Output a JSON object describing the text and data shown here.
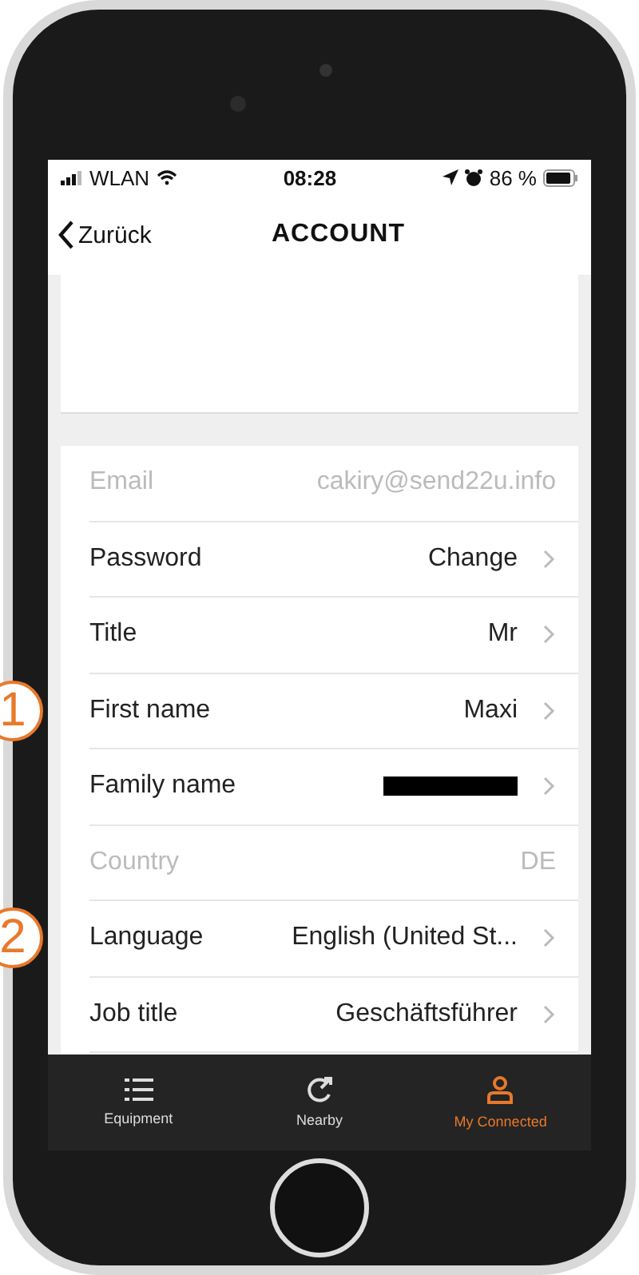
{
  "status_bar": {
    "carrier": "WLAN",
    "time": "08:28",
    "battery": "86 %"
  },
  "nav": {
    "back": "Zurück",
    "title": "ACCOUNT"
  },
  "rows": [
    {
      "label": "Email",
      "value": "cakiry@send22u.info",
      "disabled": true,
      "redacted": false
    },
    {
      "label": "Password",
      "value": "Change",
      "disabled": false,
      "redacted": false
    },
    {
      "label": "Title",
      "value": "Mr",
      "disabled": false,
      "redacted": false
    },
    {
      "label": "First name",
      "value": "Maxi",
      "disabled": false,
      "redacted": false,
      "step": "1"
    },
    {
      "label": "Family name",
      "disabled": false,
      "redacted": true
    },
    {
      "label": "Country",
      "value": "DE",
      "disabled": true,
      "redacted": false
    },
    {
      "label": "Language",
      "value": "English (United St...",
      "disabled": false,
      "redacted": false,
      "step": "2"
    },
    {
      "label": "Job title",
      "value": "Geschäftsführer",
      "disabled": false,
      "redacted": false
    }
  ],
  "tabs": [
    {
      "label": "Equipment",
      "kind": "list",
      "selected": false
    },
    {
      "label": "Nearby",
      "kind": "nearby",
      "selected": false
    },
    {
      "label": "My Connected",
      "kind": "person",
      "selected": true
    }
  ]
}
